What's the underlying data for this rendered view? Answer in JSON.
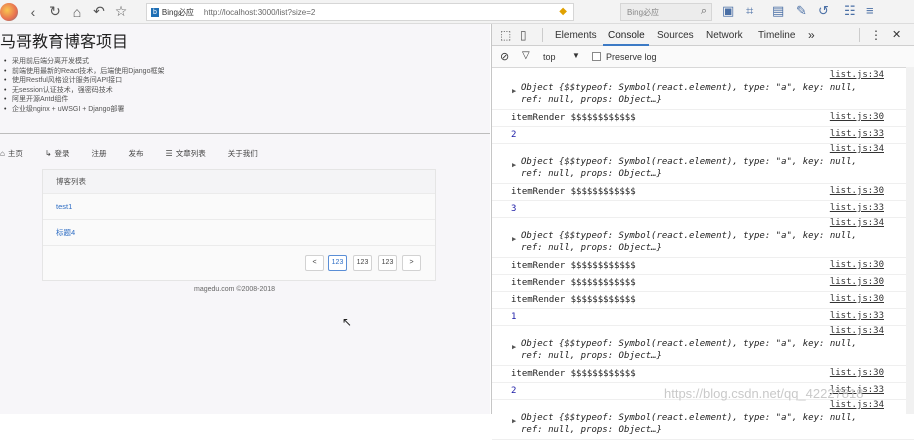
{
  "browser": {
    "search_engine_badge": "b",
    "search_engine_name": "Bing必应",
    "url": "http://localhost:3000/list?size=2",
    "search_placeholder": "Bing必应"
  },
  "page": {
    "title": "马哥教育博客项目",
    "features": [
      "采用前后端分离开发模式",
      "前端使用最新的React技术，后端使用Django框架",
      "使用Restful风格设计服务间API接口",
      "无session认证技术，强密码技术",
      "阿里开源Antd组件",
      "企业级nginx + uWSGI + Django部署"
    ],
    "menu": [
      "主页",
      "登录",
      "注册",
      "发布",
      "文章列表",
      "关于我们"
    ],
    "list_header": "博客列表",
    "list_items": [
      "test1",
      "标题4"
    ],
    "pagination": {
      "prev": "<",
      "pages": [
        "123",
        "123",
        "123"
      ],
      "next": ">"
    },
    "footer": "magedu.com ©2008-2018"
  },
  "devtools": {
    "tabs": [
      "Elements",
      "Console",
      "Sources",
      "Network",
      "Timeline"
    ],
    "more": "»",
    "menu_dots": "⋮",
    "close": "✕",
    "context": "top",
    "preserve_log": "Preserve log",
    "entries": [
      {
        "type": "obj",
        "src": "list.js:34",
        "line1": "Object {$$typeof: Symbol(react.element), type: \"a\", key: null,",
        "line2": "ref: null, props: Object…}"
      },
      {
        "type": "log",
        "src": "list.js:30",
        "text": "itemRender $$$$$$$$$$$$"
      },
      {
        "type": "num",
        "src": "list.js:33",
        "text": "2"
      },
      {
        "type": "obj",
        "src": "list.js:34",
        "line1": "Object {$$typeof: Symbol(react.element), type: \"a\", key: null,",
        "line2": "ref: null, props: Object…}"
      },
      {
        "type": "log",
        "src": "list.js:30",
        "text": "itemRender $$$$$$$$$$$$"
      },
      {
        "type": "num",
        "src": "list.js:33",
        "text": "3"
      },
      {
        "type": "obj",
        "src": "list.js:34",
        "line1": "Object {$$typeof: Symbol(react.element), type: \"a\", key: null,",
        "line2": "ref: null, props: Object…}"
      },
      {
        "type": "log",
        "src": "list.js:30",
        "text": "itemRender $$$$$$$$$$$$"
      },
      {
        "type": "log",
        "src": "list.js:30",
        "text": "itemRender $$$$$$$$$$$$"
      },
      {
        "type": "log",
        "src": "list.js:30",
        "text": "itemRender $$$$$$$$$$$$"
      },
      {
        "type": "num",
        "src": "list.js:33",
        "text": "1"
      },
      {
        "type": "obj",
        "src": "list.js:34",
        "line1": "Object {$$typeof: Symbol(react.element), type: \"a\", key: null,",
        "line2": "ref: null, props: Object…}"
      },
      {
        "type": "log",
        "src": "list.js:30",
        "text": "itemRender $$$$$$$$$$$$"
      },
      {
        "type": "num",
        "src": "list.js:33",
        "text": "2"
      },
      {
        "type": "obj",
        "src": "list.js:34",
        "line1": "Object {$$typeof: Symbol(react.element), type: \"a\", key: null,",
        "line2": "ref: null, props: Object…}"
      }
    ]
  },
  "watermark": "https://blog.csdn.net/qq_42227818"
}
